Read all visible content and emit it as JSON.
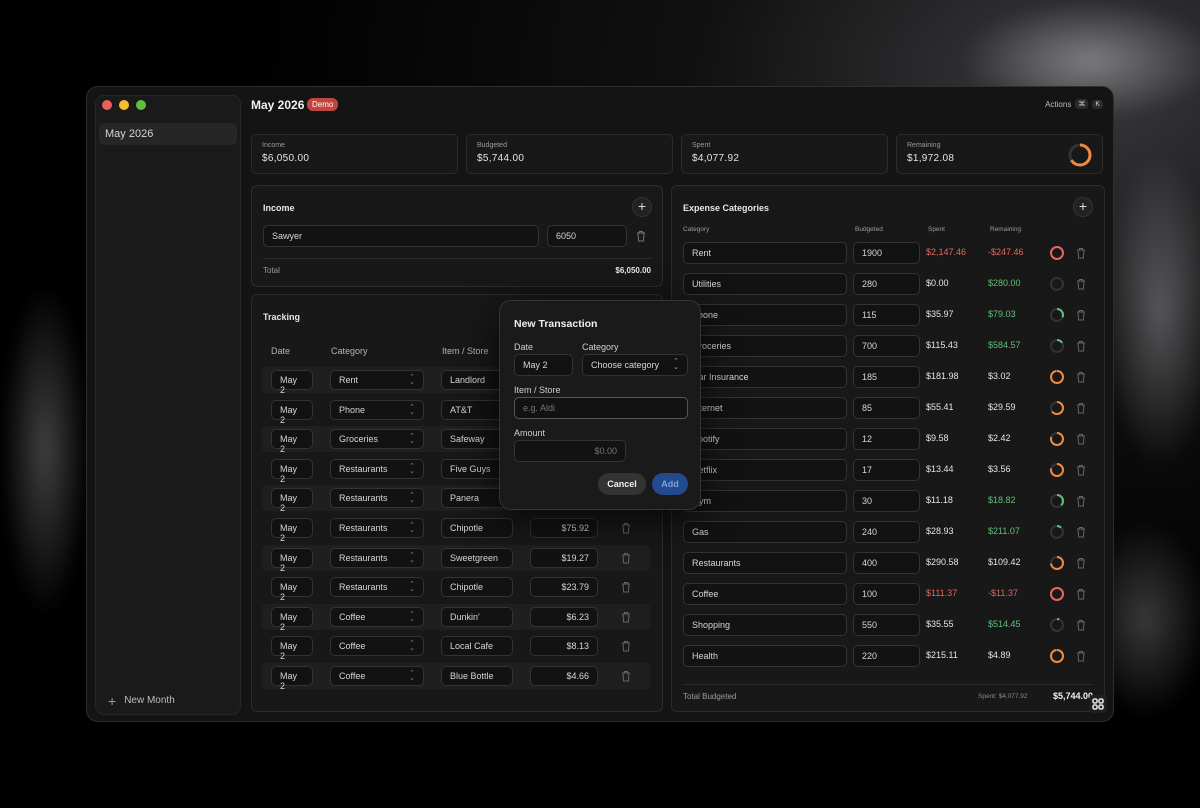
{
  "header": {
    "title": "May 2026",
    "badge": "Demo",
    "actions_label": "Actions",
    "kbd1": "⌘",
    "kbd2": "K"
  },
  "sidebar": {
    "items": [
      {
        "label": "May 2026"
      }
    ],
    "new_month_label": "New Month"
  },
  "stats": [
    {
      "label": "Income",
      "value": "$6,050.00"
    },
    {
      "label": "Budgeted",
      "value": "$5,744.00"
    },
    {
      "label": "Spent",
      "value": "$4,077.92"
    },
    {
      "label": "Remaining",
      "value": "$1,972.08"
    }
  ],
  "income": {
    "title": "Income",
    "rows": [
      {
        "name": "Sawyer",
        "amount": "6050"
      }
    ],
    "total_label": "Total",
    "total_value": "$6,050.00"
  },
  "tracking": {
    "title": "Tracking",
    "columns": [
      "Date",
      "Category",
      "Item / Store"
    ],
    "rows": [
      {
        "date": "May 2",
        "category": "Rent",
        "item": "Landlord",
        "amount": ""
      },
      {
        "date": "May 2",
        "category": "Phone",
        "item": "AT&T",
        "amount": ""
      },
      {
        "date": "May 2",
        "category": "Groceries",
        "item": "Safeway",
        "amount": ""
      },
      {
        "date": "May 2",
        "category": "Restaurants",
        "item": "Five Guys",
        "amount": ""
      },
      {
        "date": "May 2",
        "category": "Restaurants",
        "item": "Panera",
        "amount": ""
      },
      {
        "date": "May 2",
        "category": "Restaurants",
        "item": "Chipotle",
        "amount": "$75.92"
      },
      {
        "date": "May 2",
        "category": "Restaurants",
        "item": "Sweetgreen",
        "amount": "$19.27"
      },
      {
        "date": "May 2",
        "category": "Restaurants",
        "item": "Chipotle",
        "amount": "$23.79"
      },
      {
        "date": "May 2",
        "category": "Coffee",
        "item": "Dunkin'",
        "amount": "$6.23"
      },
      {
        "date": "May 2",
        "category": "Coffee",
        "item": "Local Cafe",
        "amount": "$8.13"
      },
      {
        "date": "May 2",
        "category": "Coffee",
        "item": "Blue Bottle",
        "amount": "$4.66"
      }
    ]
  },
  "modal": {
    "title": "New Transaction",
    "date_label": "Date",
    "date_value": "May 2",
    "category_label": "Category",
    "category_value": "Choose category",
    "item_label": "Item / Store",
    "item_placeholder": "e.g. Aldi",
    "amount_label": "Amount",
    "amount_placeholder": "$0.00",
    "cancel_label": "Cancel",
    "add_label": "Add"
  },
  "expenses": {
    "title": "Expense Categories",
    "columns": [
      "Category",
      "Budgeted",
      "Spent",
      "Remaining"
    ],
    "rows": [
      {
        "name": "Rent",
        "budgeted": "1900",
        "spent": "$2,147.46",
        "remaining": "-$247.46",
        "status": "over",
        "progress": 1.0
      },
      {
        "name": "Utilities",
        "budgeted": "280",
        "spent": "$0.00",
        "remaining": "$280.00",
        "status": "ok",
        "progress": 0.0
      },
      {
        "name": "Phone",
        "budgeted": "115",
        "spent": "$35.97",
        "remaining": "$79.03",
        "status": "ok",
        "progress": 0.31
      },
      {
        "name": "Groceries",
        "budgeted": "700",
        "spent": "$115.43",
        "remaining": "$584.57",
        "status": "ok",
        "progress": 0.16
      },
      {
        "name": "Car Insurance",
        "budgeted": "185",
        "spent": "$181.98",
        "remaining": "$3.02",
        "status": "warn",
        "progress": 0.98
      },
      {
        "name": "Internet",
        "budgeted": "85",
        "spent": "$55.41",
        "remaining": "$29.59",
        "status": "warn",
        "progress": 0.65
      },
      {
        "name": "Spotify",
        "budgeted": "12",
        "spent": "$9.58",
        "remaining": "$2.42",
        "status": "warn",
        "progress": 0.8
      },
      {
        "name": "Netflix",
        "budgeted": "17",
        "spent": "$13.44",
        "remaining": "$3.56",
        "status": "warn",
        "progress": 0.79
      },
      {
        "name": "Gym",
        "budgeted": "30",
        "spent": "$11.18",
        "remaining": "$18.82",
        "status": "ok",
        "progress": 0.37
      },
      {
        "name": "Gas",
        "budgeted": "240",
        "spent": "$28.93",
        "remaining": "$211.07",
        "status": "ok",
        "progress": 0.12
      },
      {
        "name": "Restaurants",
        "budgeted": "400",
        "spent": "$290.58",
        "remaining": "$109.42",
        "status": "warn",
        "progress": 0.73
      },
      {
        "name": "Coffee",
        "budgeted": "100",
        "spent": "$111.37",
        "remaining": "-$11.37",
        "status": "over",
        "progress": 1.0
      },
      {
        "name": "Shopping",
        "budgeted": "550",
        "spent": "$35.55",
        "remaining": "$514.45",
        "status": "ok",
        "progress": 0.06
      },
      {
        "name": "Health",
        "budgeted": "220",
        "spent": "$215.11",
        "remaining": "$4.89",
        "status": "warn",
        "progress": 0.98
      }
    ],
    "total_label": "Total Budgeted",
    "total_spent": "Spent: $4,077.92",
    "total_value": "$5,744.00"
  },
  "colors": {
    "over": "#e5665f",
    "warn": "#f08a3e",
    "ok": "#5fc07a",
    "traffic": [
      "#ee5f57",
      "#f5bd2f",
      "#5fc13f"
    ]
  },
  "remaining_progress": 0.66
}
